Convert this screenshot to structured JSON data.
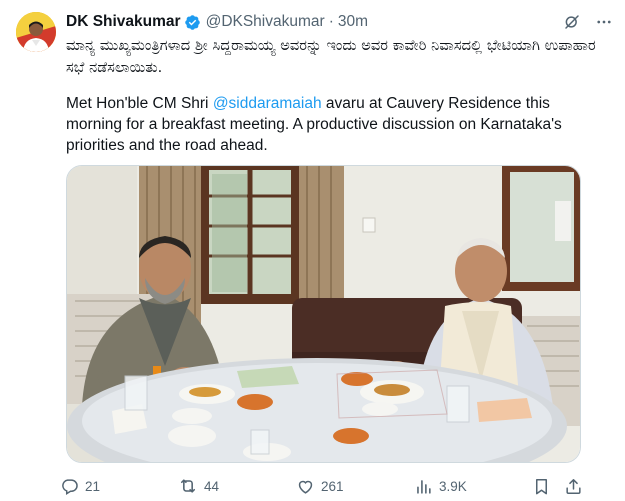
{
  "author": {
    "display_name": "DK Shivakumar",
    "handle": "@DKShivakumar",
    "separator": "·",
    "time": "30m"
  },
  "tweet": {
    "kannada_text": "ಮಾನ್ಯ ಮುಖ್ಯಮಂತ್ರಿಗಳಾದ ಶ್ರೀ ಸಿದ್ದರಾಮಯ್ಯ ಅವರನ್ನು ಇಂದು ಅವರ ಕಾವೇರಿ ನಿವಾಸದಲ್ಲಿ ಭೇಟಿಯಾಗಿ ಉಪಾಹಾರ ಸಭೆ ನಡೆಸಲಾಯಿತು.",
    "english_prefix": "Met Hon'ble CM Shri ",
    "mention": "@siddaramaiah",
    "english_suffix": " avaru at Cauvery Residence this morning for a breakfast meeting. A productive discussion on Karnataka's priorities and the road ahead."
  },
  "metrics": {
    "replies": "21",
    "reposts": "44",
    "likes": "261",
    "views": "3.9K"
  },
  "icons": {
    "verified": "verified-badge-icon",
    "grok": "grok-icon",
    "more": "more-icon",
    "reply": "reply-icon",
    "repost": "repost-icon",
    "like": "like-icon",
    "views": "views-icon",
    "bookmark": "bookmark-icon",
    "share": "share-icon"
  },
  "colors": {
    "accent": "#1d9bf0",
    "text_primary": "#0f1419",
    "text_secondary": "#536471",
    "border": "#cfd9de"
  }
}
